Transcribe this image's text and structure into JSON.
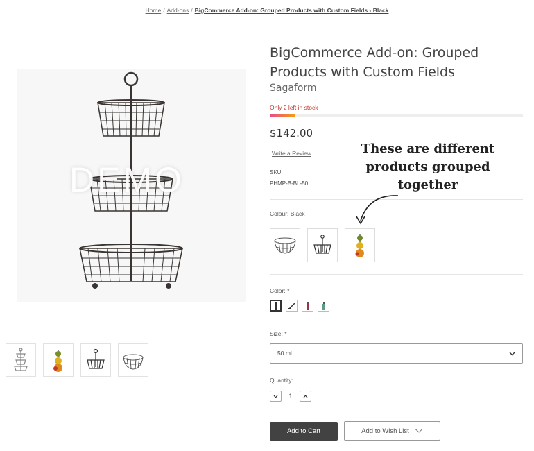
{
  "breadcrumb": {
    "items": [
      "Home",
      "Add-ons"
    ],
    "current": "BigCommerce Add-on: Grouped Products with Custom Fields - Black"
  },
  "product": {
    "title": "BigCommerce Add-on: Grouped Products with Custom Fields",
    "brand": "Sagaform",
    "stock": "Only 2 left in stock",
    "price": "$142.00",
    "review_link": "Write a Review",
    "sku_label": "SKU:",
    "sku_value": "PHMP-B-BL-50",
    "watermark": "DEMO"
  },
  "annotation": {
    "text": "These are different products grouped together"
  },
  "grouped": {
    "label": "Colour: Black"
  },
  "options": {
    "color_label": "Color:",
    "required_mark": "*",
    "size_label": "Size:",
    "size_value": "50 ml",
    "quantity_label": "Quantity:",
    "quantity_value": "1"
  },
  "actions": {
    "add_to_cart": "Add to Cart",
    "add_to_wishlist": "Add to Wish List"
  },
  "colors": {
    "button_dark": "#424242",
    "stock_text": "#c0392b",
    "basket_metal": "#3a3532"
  },
  "icons": [
    "chevron-down-icon",
    "minus-icon",
    "plus-icon",
    "curved-arrow-icon"
  ]
}
